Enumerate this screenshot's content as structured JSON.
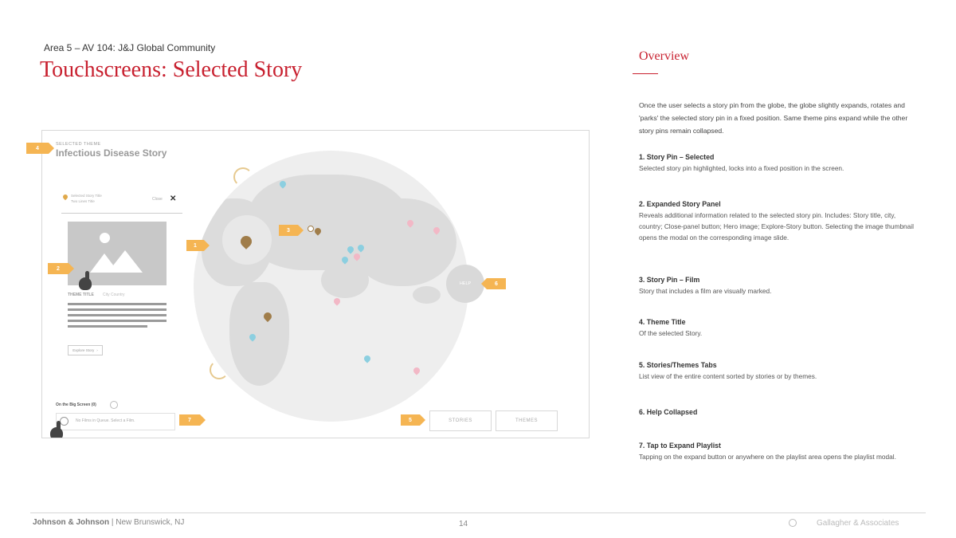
{
  "header": {
    "subtitle": "Area 5 – AV 104: J&J Global Community",
    "title": "Touchscreens: Selected Story"
  },
  "overview": {
    "heading": "Overview",
    "intro": "Once the user selects a story pin from the globe, the globe slightly expands, rotates and 'parks' the selected story pin in a fixed position. Same theme pins expand while the other story pins remain collapsed.",
    "items": [
      {
        "title": "1. Story Pin – Selected",
        "body": "Selected story pin highlighted, locks into a fixed position in the screen."
      },
      {
        "title": "2. Expanded Story Panel",
        "body": "Reveals additional information related to the selected story pin. Includes: Story title, city, country; Close-panel button; Hero image; Explore-Story button. Selecting the image thumbnail opens the modal on the corresponding image slide."
      },
      {
        "title": "3. Story Pin – Film",
        "body": "Story that includes a film are visually marked."
      },
      {
        "title": "4. Theme Title",
        "body": "Of the selected Story."
      },
      {
        "title": "5. Stories/Themes Tabs",
        "body": "List view of the entire content sorted by stories or by themes."
      },
      {
        "title": "6. Help Collapsed",
        "body": ""
      },
      {
        "title": "7. Tap to Expand Playlist",
        "body": "Tapping on the expand button or anywhere on the playlist area opens the playlist modal."
      }
    ]
  },
  "mockup": {
    "theme_label": "SELECTED THEME",
    "theme_title": "Infectious Disease Story",
    "panel": {
      "story_title": "Selected Story Title",
      "story_title_line2": "Two Lines Title",
      "close_label": "Close",
      "close_glyph": "✕",
      "meta_label": "THEME TITLE",
      "meta_location": "City Country",
      "explore_label": "Explore Story",
      "explore_glyph": "›"
    },
    "big_screen_label": "On the Big Screen (0)",
    "playlist_text": "No Films in Queue. Select a Film.",
    "help_label": "HELP",
    "tabs": [
      "STORIES",
      "THEMES"
    ],
    "callouts": [
      "1",
      "2",
      "3",
      "4",
      "5",
      "6",
      "7"
    ],
    "colors": {
      "pin_gold": "#a07d4a",
      "pin_blue": "#8ccfe0",
      "pin_pink": "#f2b8c6",
      "callout": "#f5b553",
      "accent_red": "#c8202f"
    },
    "icons": [
      "map-pin-icon",
      "close-icon",
      "image-placeholder-icon",
      "hand-pointer-icon",
      "film-icon",
      "play-circle-icon"
    ]
  },
  "footer": {
    "company": "Johnson & Johnson",
    "separator": " | ",
    "location": "New Brunswick, NJ",
    "page_number": "14",
    "agency": "Gallagher & Associates"
  }
}
